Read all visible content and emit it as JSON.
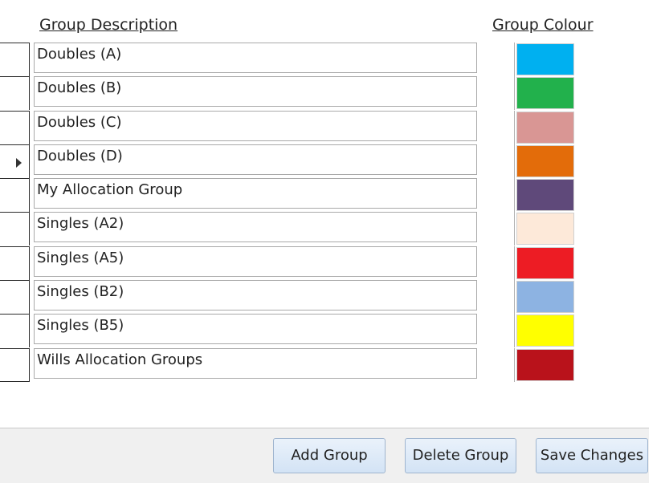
{
  "headers": {
    "description": "Group Description",
    "colour": "Group Colour"
  },
  "groups": [
    {
      "description": "Doubles (A)",
      "colour": "#00b0f0",
      "current": false
    },
    {
      "description": "Doubles (B)",
      "colour": "#22b14c",
      "current": false
    },
    {
      "description": "Doubles (C)",
      "colour": "#d99694",
      "current": false
    },
    {
      "description": "Doubles (D)",
      "colour": "#e36c0a",
      "current": true
    },
    {
      "description": "My Allocation Group",
      "colour": "#5f497a",
      "current": false
    },
    {
      "description": "Singles (A2)",
      "colour": "#fde9d9",
      "current": false
    },
    {
      "description": "Singles (A5)",
      "colour": "#ed1c24",
      "current": false
    },
    {
      "description": "Singles (B2)",
      "colour": "#8db3e2",
      "current": false
    },
    {
      "description": "Singles (B5)",
      "colour": "#ffff00",
      "current": false
    },
    {
      "description": "Wills Allocation Groups",
      "colour": "#b9121b",
      "current": false
    }
  ],
  "buttons": {
    "add": "Add Group",
    "delete": "Delete Group",
    "save": "Save Changes"
  }
}
